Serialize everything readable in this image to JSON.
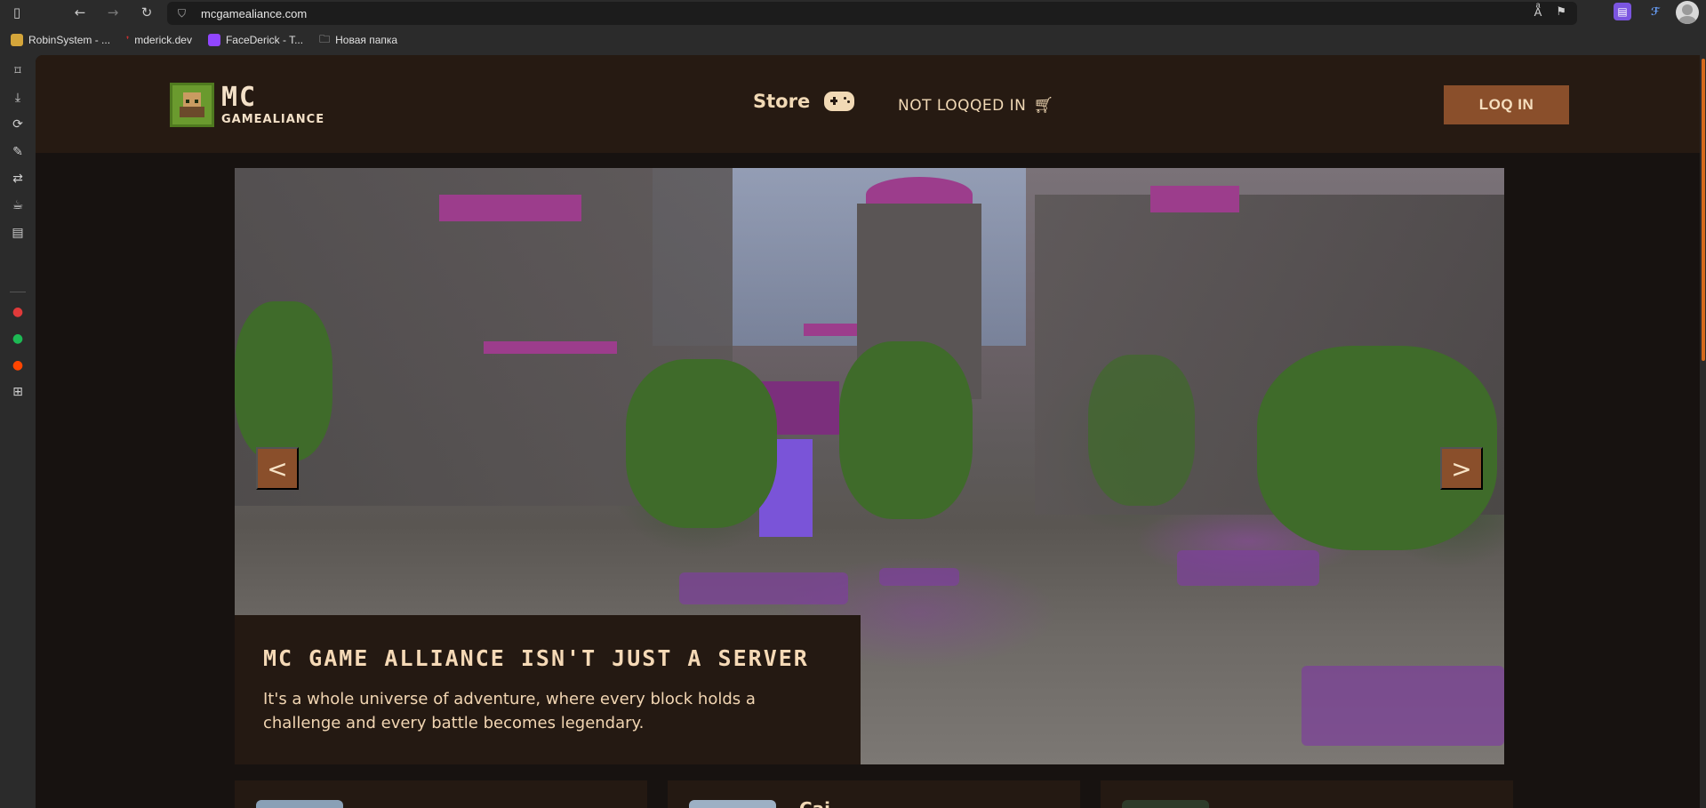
{
  "browser": {
    "url": "mcgamealiance.com",
    "bookmarks": [
      {
        "label": "RobinSystem - ...",
        "color": "#d4a53a"
      },
      {
        "label": "mderick.dev",
        "color": "#d23030"
      },
      {
        "label": "FaceDerick - T...",
        "color": "#9146ff"
      },
      {
        "label": "Новая папка",
        "color": "#cfcfcf"
      }
    ],
    "sidebar_icons": [
      "bookmarks-icon",
      "download-icon",
      "history-icon",
      "notes-icon",
      "translate-icon",
      "coffee-icon",
      "reader-icon",
      "vivaldi-icon",
      "spotify-icon",
      "reddit-icon",
      "add-panel-icon"
    ]
  },
  "site": {
    "logo": {
      "line1": "MC",
      "line2": "GAMEALIANCE"
    },
    "nav": {
      "store_label": "Store",
      "user_status": "NOT LOQQED IN",
      "login_label": "LOQ IN"
    },
    "hero": {
      "prev_label": "<",
      "next_label": ">",
      "title": "MC GAME ALLIANCE ISN'T JUST A SERVER",
      "text": "It's a whole universe of adventure, where every block holds a challenge and every battle becomes legendary."
    },
    "cards": [
      {
        "title": ""
      },
      {
        "title": "Cai..."
      },
      {
        "title": ""
      }
    ]
  },
  "colors": {
    "accent": "#8a4f2b",
    "header_bg": "#261a12",
    "page_bg": "#171210",
    "text_cream": "#f1d9b5"
  }
}
